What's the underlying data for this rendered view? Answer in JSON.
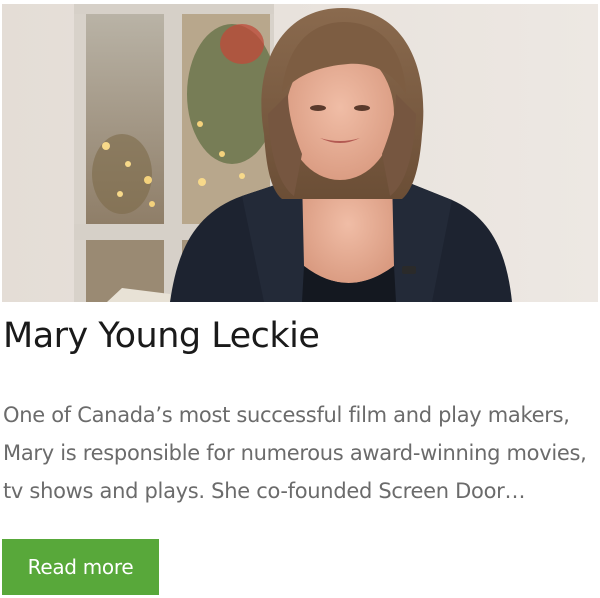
{
  "article": {
    "image_alt": "Portrait of Mary Young Leckie",
    "title": "Mary Young Leckie",
    "excerpt": "One of Canada’s most successful film and play makers, Mary is responsible for numerous award-winning movies, tv shows and plays. She co-founded Screen Door…",
    "read_more_label": "Read more"
  },
  "colors": {
    "button_bg": "#58a83a",
    "button_text": "#ffffff",
    "title_text": "#1a1a1a",
    "excerpt_text": "#6b6b6b"
  }
}
